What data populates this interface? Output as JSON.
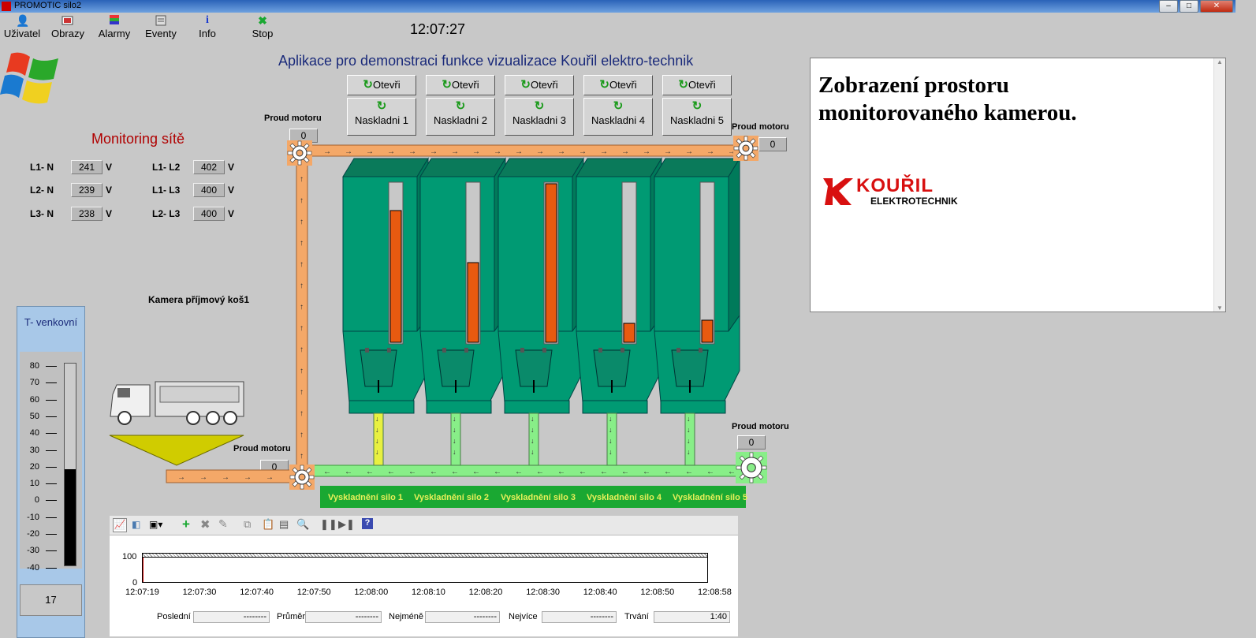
{
  "window": {
    "title": "PROMOTIC silo2"
  },
  "toolbar": {
    "items": [
      {
        "label": "Uživatel",
        "icon": "user-icon"
      },
      {
        "label": "Obrazy",
        "icon": "screens-icon"
      },
      {
        "label": "Alarmy",
        "icon": "alarm-icon"
      },
      {
        "label": "Eventy",
        "icon": "events-icon"
      },
      {
        "label": "Info",
        "icon": "info-icon"
      },
      {
        "label": "Stop",
        "icon": "stop-icon"
      }
    ],
    "clock": "12:07:27"
  },
  "app_title": "Aplikace pro demonstraci funkce vizualizace Kouřil elektro-technik",
  "monitoring": {
    "title": "Monitoring sítě",
    "unit": "V",
    "rows": [
      {
        "label": "L1- N",
        "value": "241"
      },
      {
        "label": "L2- N",
        "value": "239"
      },
      {
        "label": "L3- N",
        "value": "238"
      },
      {
        "label": "L1- L2",
        "value": "402"
      },
      {
        "label": "L1- L3",
        "value": "400"
      },
      {
        "label": "L2- L3",
        "value": "400"
      }
    ]
  },
  "silo_controls": {
    "open_label": "Otevři",
    "load_labels": [
      "Naskladni 1",
      "Naskladni 2",
      "Naskladni 3",
      "Naskladni 4",
      "Naskladni 5"
    ]
  },
  "silo_levels": [
    0.83,
    0.5,
    1.0,
    0.12,
    0.14
  ],
  "unload_buttons": [
    "Vyskladnění silo 1",
    "Vyskladnění silo 2",
    "Vyskladnění silo 3",
    "Vyskladnění silo 4",
    "Vyskladnění silo 5"
  ],
  "motors": {
    "label": "Proud motoru",
    "values": [
      "0",
      "0",
      "0",
      "0"
    ]
  },
  "camera": {
    "label": "Kamera příjmový koš1",
    "panel_text": "Zobrazení prostoru monitorovaného kamerou.",
    "logo_name": "KOUŘIL",
    "logo_sub": "ELEKTROTECHNIK"
  },
  "temperature": {
    "title": "T- venkovní",
    "value": "17",
    "scale": [
      "80",
      "70",
      "60",
      "50",
      "40",
      "30",
      "20",
      "10",
      "0",
      "-10",
      "-20",
      "-30",
      "-40"
    ],
    "min": -40,
    "max": 80
  },
  "trend": {
    "y_ticks": [
      "100",
      "0"
    ],
    "x_ticks": [
      "12:07:19",
      "12:07:30",
      "12:07:40",
      "12:07:50",
      "12:08:00",
      "12:08:10",
      "12:08:20",
      "12:08:30",
      "12:08:40",
      "12:08:50",
      "12:08:58"
    ],
    "stats": [
      {
        "label": "Poslední",
        "value": "--------"
      },
      {
        "label": "Průměr",
        "value": "--------"
      },
      {
        "label": "Nejméně",
        "value": "--------"
      },
      {
        "label": "Nejvíce",
        "value": "--------"
      },
      {
        "label": "Trvání",
        "value": "1:40"
      }
    ]
  },
  "colors": {
    "silo": "#009a73",
    "fill": "#e85a10",
    "conveyor_orange": "#f4a868",
    "conveyor_green": "#88ee88",
    "unload_bar": "#1aa832"
  }
}
